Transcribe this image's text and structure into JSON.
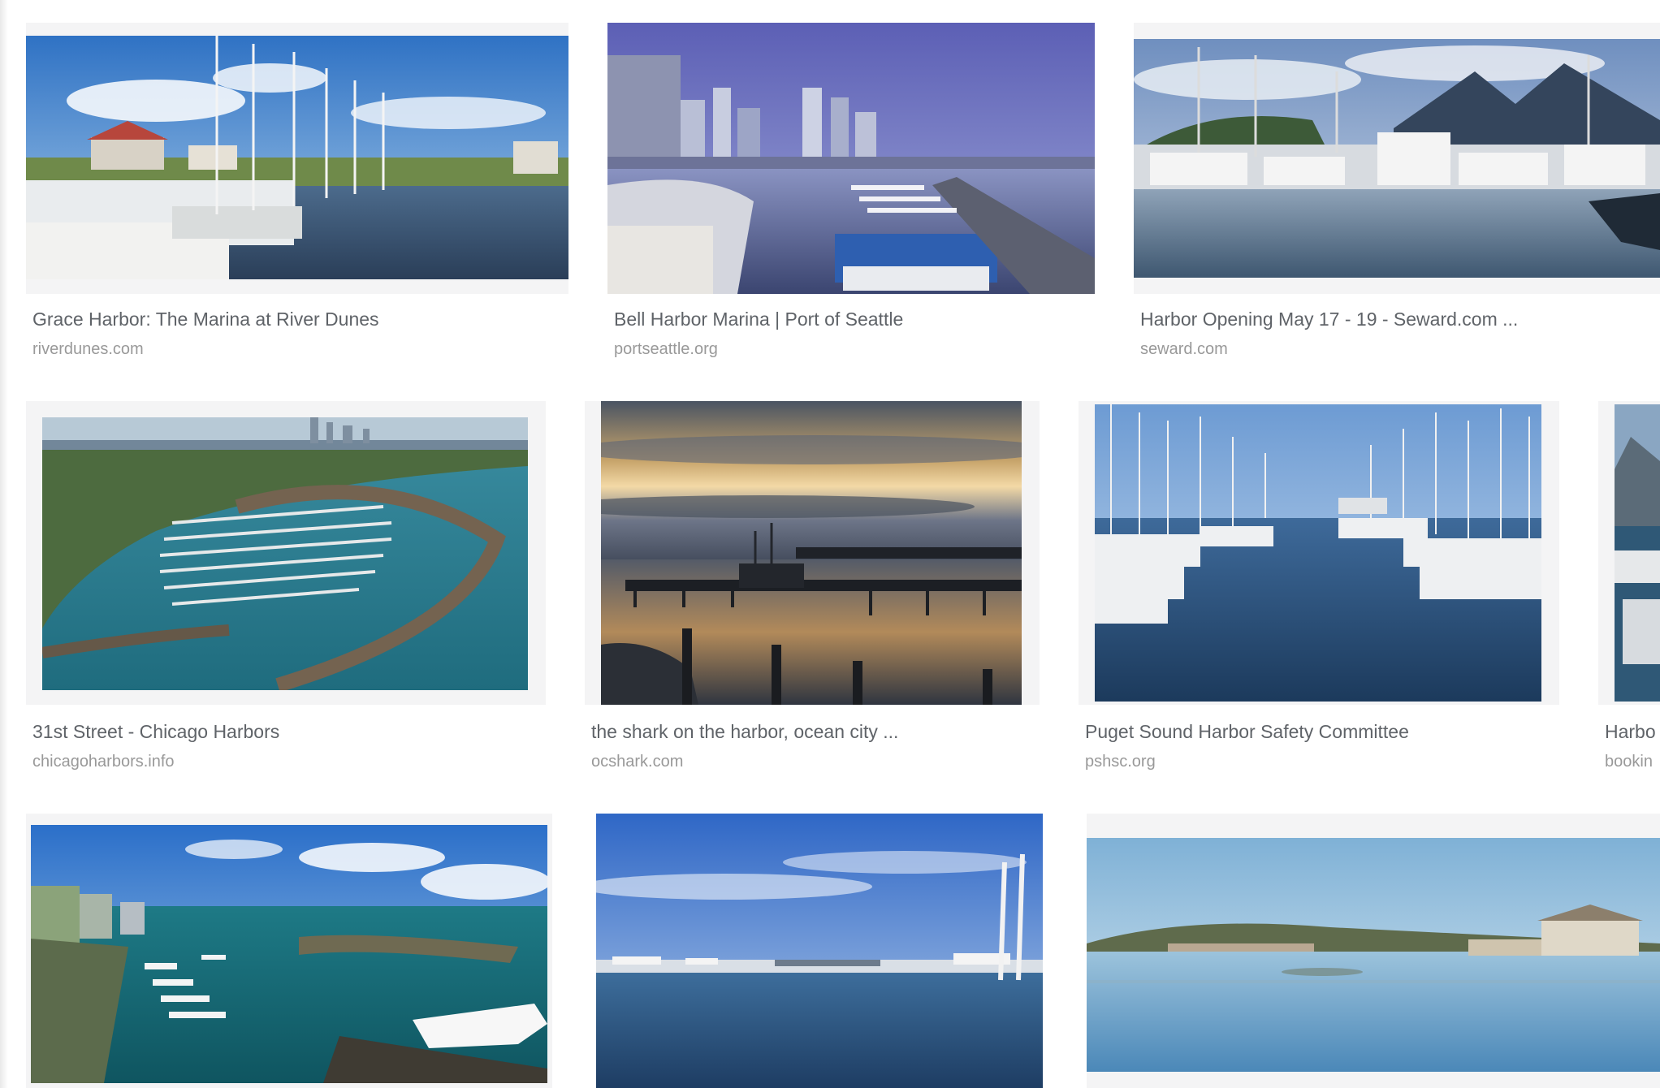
{
  "results": [
    {
      "title": "Grace Harbor: The Marina at River Dunes",
      "site": "riverdunes.com",
      "image": "marina with sailboats and waterfront houses"
    },
    {
      "title": "Bell Harbor Marina | Port of Seattle",
      "site": "portseattle.org",
      "image": "city skyline over marina at dusk"
    },
    {
      "title": "Harbor Opening May 17 - 19 - Seward.com ...",
      "site": "seward.com",
      "image": "fishing boats in harbor below mountains"
    },
    {
      "title": "31st Street - Chicago Harbors",
      "site": "chicagoharbors.info",
      "image": "aerial view of curved breakwater harbor"
    },
    {
      "title": "the shark on the harbor, ocean city ...",
      "site": "ocshark.com",
      "image": "pier silhouette at sunset"
    },
    {
      "title": "Puget Sound Harbor Safety Committee",
      "site": "pshsc.org",
      "image": "rows of sailboat masts in marina"
    },
    {
      "title": "Harbo",
      "site": "bookin",
      "image": "partially visible marina photo"
    },
    {
      "title": "",
      "site": "",
      "image": "aerial tropical harbor with yacht"
    },
    {
      "title": "",
      "site": "",
      "image": "calm blue harbor water with boats"
    },
    {
      "title": "",
      "site": "",
      "image": "calm harbor with waterfront buildings"
    }
  ]
}
